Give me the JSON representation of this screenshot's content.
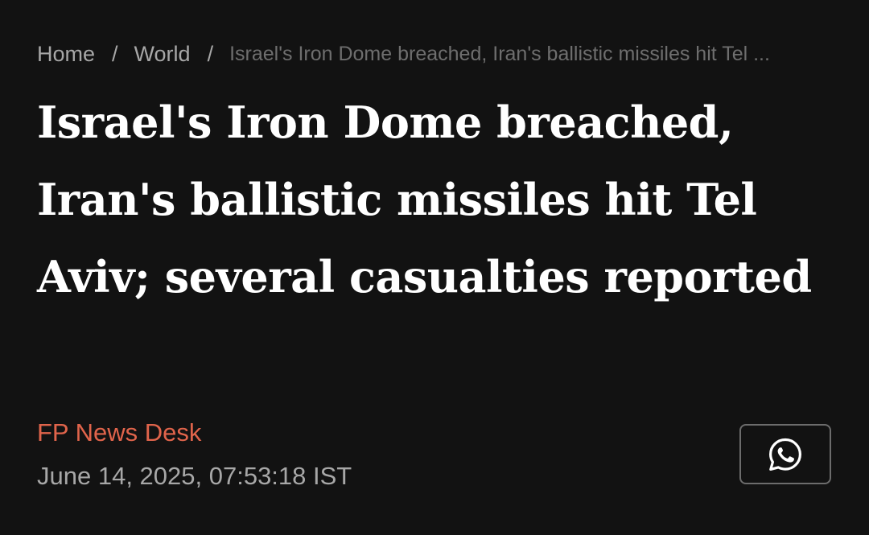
{
  "breadcrumb": {
    "home": "Home",
    "separator_1": "/",
    "section": "World",
    "separator_2": "/",
    "current": "Israel's Iron Dome breached, Iran's ballistic missiles hit Tel ..."
  },
  "article": {
    "headline": "Israel's Iron Dome breached, Iran's ballistic missiles hit Tel Aviv; several casualties reported",
    "author": "FP News Desk",
    "published": "June 14, 2025, 07:53:18 IST"
  },
  "share": {
    "icon": "whatsapp-icon"
  },
  "colors": {
    "background": "#121212",
    "headline": "#ffffff",
    "author_accent": "#e0644b",
    "muted_text": "#a7a7a7",
    "dim_text": "#6e6e6e",
    "button_border": "#6c6c6c"
  }
}
